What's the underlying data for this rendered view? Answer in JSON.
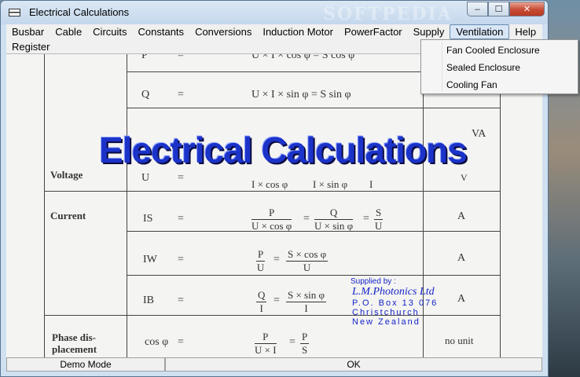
{
  "window": {
    "title": "Electrical Calculations",
    "watermark": "SOFTPEDIA",
    "minimize": "‒",
    "maximize": "☐",
    "close": "✕"
  },
  "menu": {
    "row1": [
      "Busbar",
      "Cable",
      "Circuits",
      "Constants",
      "Conversions",
      "Induction Motor",
      "PowerFactor",
      "Supply",
      "Ventilation",
      "Help"
    ],
    "row2": [
      "Register"
    ],
    "active": "Ventilation"
  },
  "ventilation_menu": [
    "Fan Cooled Enclosure",
    "Sealed Enclosure",
    "Cooling Fan"
  ],
  "splash": {
    "title": "Electrical Calculations",
    "supplied_by": "Supplied by :",
    "company": "L.M.Photonics Ltd",
    "address": [
      "P.O. Box 13 076",
      "Christchurch",
      "New Zealand"
    ]
  },
  "table": {
    "r0": {
      "sym": "P",
      "eq": "=",
      "formula": "U × I × cos φ = S cos φ"
    },
    "r1": {
      "sym": "Q",
      "eq": "=",
      "formula": "U × I × sin φ = S sin φ"
    },
    "r2": {
      "unit": "VA"
    },
    "voltage": {
      "label": "Voltage",
      "sym": "U",
      "eq": "=",
      "f1": "I × cos φ",
      "f2": "I × sin φ",
      "f3": "I",
      "unit": "V"
    },
    "current": {
      "label": "Current",
      "is": {
        "sym": "IS",
        "eq": "=",
        "n1": "P",
        "d1": "U × cos φ",
        "n2": "Q",
        "d2": "U × sin φ",
        "n3": "S",
        "d3": "U",
        "unit": "A"
      },
      "iw": {
        "sym": "IW",
        "eq": "=",
        "n1": "P",
        "d1": "U",
        "n2": "S × cos φ",
        "d2": "U",
        "unit": "A"
      },
      "ib": {
        "sym": "IB",
        "eq": "=",
        "n1": "Q",
        "d1": "I",
        "n2": "S × sin φ",
        "d2": "I",
        "unit": "A"
      }
    },
    "phase": {
      "label1": "Phase dis-",
      "label2": "placement",
      "sym": "cos φ",
      "eq": "=",
      "n1": "P",
      "d1": "U × I",
      "n2": "P",
      "d2": "S",
      "unit": "no unit"
    }
  },
  "status": {
    "mode": "Demo Mode",
    "ok": "OK"
  },
  "colors": {
    "title_blue": "#1b33c9",
    "supplier_blue": "#1524c7"
  }
}
